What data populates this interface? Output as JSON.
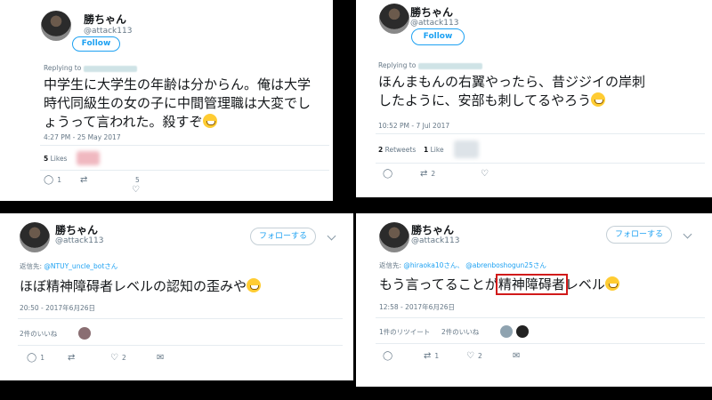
{
  "tweets": [
    {
      "name": "勝ちゃん",
      "handle": "@attack113",
      "follow_label": "Follow",
      "reply_prefix": "Replying to",
      "reply_mentions": [],
      "text_lines": [
        "中学生に大学生の年齢は分からん。俺は大学",
        "時代同級生の女の子に中間管理職は大変でし",
        "ょうって言われた。殺すぞ"
      ],
      "emoji": "grinning-sweat-emoji",
      "timestamp": "4:27 PM - 25 May 2017",
      "stats": {
        "likes_count": "5",
        "likes_label": "Likes"
      },
      "actions": {
        "reply_count": "1",
        "retweet_count": "",
        "like_count": "5"
      }
    },
    {
      "name": "勝ちゃん",
      "handle": "@attack113",
      "follow_label": "Follow",
      "reply_prefix": "Replying to",
      "reply_mentions": [],
      "text_lines": [
        "ほんまもんの右翼やったら、昔ジジイの岸刺",
        "したように、安部も刺してるやろう"
      ],
      "emoji": "grinning-sweat-emoji",
      "timestamp": "10:52 PM - 7 Jul 2017",
      "stats": {
        "retweets_count": "2",
        "retweets_label": "Retweets",
        "likes_count": "1",
        "likes_label": "Like"
      },
      "actions": {
        "reply_count": "",
        "retweet_count": "2",
        "like_count": ""
      }
    },
    {
      "name": "勝ちゃん",
      "handle": "@attack113",
      "follow_label": "フォローする",
      "reply_prefix": "返信先:",
      "reply_mentions": [
        "@NTUY_uncle_botさん"
      ],
      "text_lines": [
        "ほぼ精神障碍者レベルの認知の歪みや"
      ],
      "emoji": "sweat-smile-emoji",
      "timestamp": "20:50 - 2017年6月26日",
      "stats": {
        "likes_text": "2件のいいね"
      },
      "actions": {
        "reply_count": "1",
        "retweet_count": "",
        "like_count": "2"
      }
    },
    {
      "name": "勝ちゃん",
      "handle": "@attack113",
      "follow_label": "フォローする",
      "reply_prefix": "返信先:",
      "reply_mentions": [
        "@hiraoka10さん、",
        "@abrenboshogun25さん"
      ],
      "text_before": "もう言ってることが",
      "text_highlight": "精神障碍者",
      "text_after": "レベル",
      "emoji": "sweat-smile-emoji",
      "timestamp": "12:58 - 2017年6月26日",
      "stats": {
        "retweets_text": "1件のリツイート",
        "likes_text": "2件のいいね"
      },
      "actions": {
        "reply_count": "",
        "retweet_count": "1",
        "like_count": "2"
      },
      "highlight_color": "#d11a1a"
    }
  ],
  "colors": {
    "link": "#1da1f2",
    "muted": "#657786",
    "highlight": "#d11a1a"
  }
}
